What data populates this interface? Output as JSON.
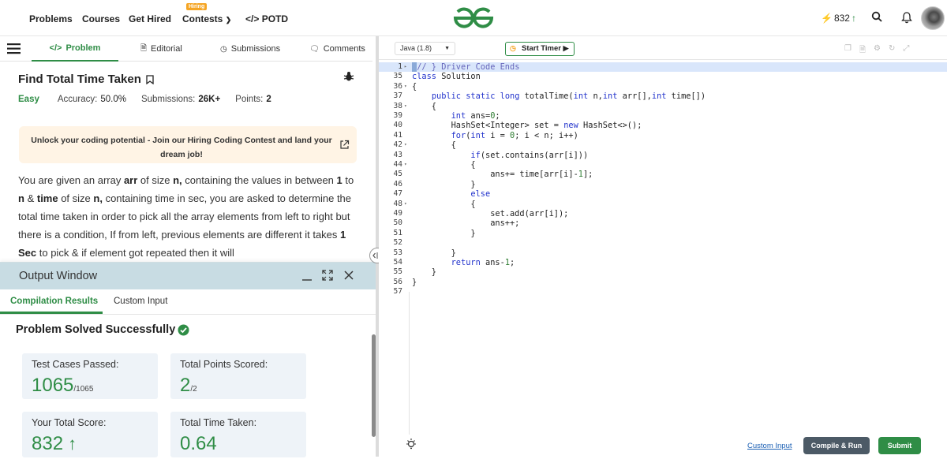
{
  "nav": {
    "items": [
      "Problems",
      "Courses",
      "Get Hired",
      "Contests",
      "POTD"
    ],
    "hiring_badge": "Hiring",
    "streak": "832",
    "colors": {
      "brand": "#2f8d46"
    }
  },
  "tabs": {
    "problem": "Problem",
    "editorial": "Editorial",
    "submissions": "Submissions",
    "comments": "Comments"
  },
  "problem": {
    "title": "Find Total Time Taken",
    "difficulty": "Easy",
    "accuracy_label": "Accuracy:",
    "accuracy_value": "50.0%",
    "submissions_label": "Submissions:",
    "submissions_value": "26K+",
    "points_label": "Points:",
    "points_value": "2",
    "banner": "Unlock your coding potential - Join our Hiring Coding Contest and land your dream job!",
    "desc": {
      "p1": "You are given an array ",
      "arr": "arr",
      "p2": " of size ",
      "n1": "n,",
      "p3": " containing the values in between ",
      "one": "1",
      "p4": " to ",
      "n2": "n",
      "p5": " & ",
      "time": "time",
      "p6": " of size ",
      "n3": "n,",
      "p7": " containing time in sec, you are asked to determine the total time taken in order to pick all the array elements from left to right but there is a condition, If from left, previous elements are different it takes ",
      "onesec": "1 Sec",
      "p8": " to pick & if element got repeated then it will"
    }
  },
  "output": {
    "title": "Output Window",
    "tab_results": "Compilation Results",
    "tab_custom": "Custom Input",
    "solved": "Problem Solved Successfully",
    "cards": {
      "tests_label": "Test Cases Passed:",
      "tests_value": "1065",
      "tests_total": "/1065",
      "points_label": "Total Points Scored:",
      "points_value": "2",
      "points_total": "/2",
      "score_label": "Your Total Score:",
      "score_value": "832",
      "time_label": "Total Time Taken:",
      "time_value": "0.64"
    }
  },
  "editor": {
    "language": "Java (1.8)",
    "timer": "Start Timer",
    "lines": [
      {
        "n": "1",
        "fold": "▸",
        "text": "// } Driver Code Ends"
      },
      {
        "n": "35",
        "fold": "",
        "text": "class Solution"
      },
      {
        "n": "36",
        "fold": "▾",
        "text": "{"
      },
      {
        "n": "37",
        "fold": "",
        "text": "    public static long totalTime(int n,int arr[],int time[])"
      },
      {
        "n": "38",
        "fold": "▾",
        "text": "    {"
      },
      {
        "n": "39",
        "fold": "",
        "text": "        int ans=0;"
      },
      {
        "n": "40",
        "fold": "",
        "text": "        HashSet<Integer> set = new HashSet<>();"
      },
      {
        "n": "41",
        "fold": "",
        "text": "        for(int i = 0; i < n; i++)"
      },
      {
        "n": "42",
        "fold": "▾",
        "text": "        {"
      },
      {
        "n": "43",
        "fold": "",
        "text": "            if(set.contains(arr[i]))"
      },
      {
        "n": "44",
        "fold": "▾",
        "text": "            {"
      },
      {
        "n": "45",
        "fold": "",
        "text": "                ans+= time[arr[i]-1];"
      },
      {
        "n": "46",
        "fold": "",
        "text": "            }"
      },
      {
        "n": "47",
        "fold": "",
        "text": "            else"
      },
      {
        "n": "48",
        "fold": "▾",
        "text": "            {"
      },
      {
        "n": "49",
        "fold": "",
        "text": "                set.add(arr[i]);"
      },
      {
        "n": "50",
        "fold": "",
        "text": "                ans++;"
      },
      {
        "n": "51",
        "fold": "",
        "text": "            }"
      },
      {
        "n": "52",
        "fold": "",
        "text": ""
      },
      {
        "n": "53",
        "fold": "",
        "text": "        }"
      },
      {
        "n": "54",
        "fold": "",
        "text": "        return ans-1;"
      },
      {
        "n": "55",
        "fold": "",
        "text": "    }"
      },
      {
        "n": "56",
        "fold": "",
        "text": "}"
      },
      {
        "n": "57",
        "fold": "",
        "text": ""
      }
    ]
  },
  "footer": {
    "custom_input": "Custom Input",
    "compile_run": "Compile & Run",
    "submit": "Submit"
  }
}
